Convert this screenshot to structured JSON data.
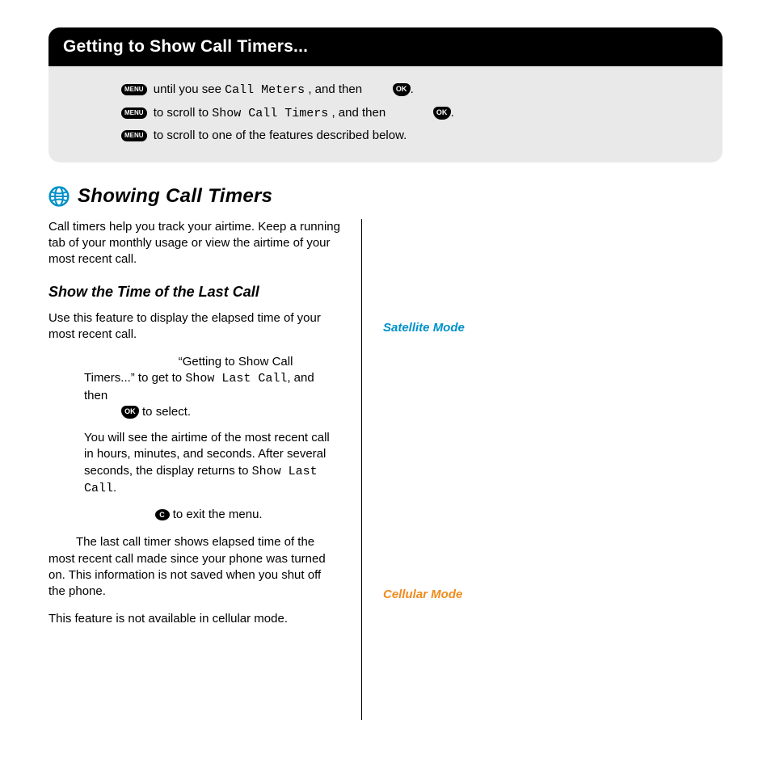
{
  "header": {
    "title": "Getting to Show Call Timers..."
  },
  "steps": {
    "s1a": " until you see ",
    "s1m": "Call Meters",
    "s1b": ", and then ",
    "s2a": " to scroll to ",
    "s2m": "Show Call Timers",
    "s2b": ", and then ",
    "s3a": " to scroll to one of the features described below."
  },
  "badges": {
    "menu": "MENU",
    "ok": "OK",
    "c": "C"
  },
  "section": {
    "title": "Showing Call Timers"
  },
  "intro": "Call timers help you track your airtime. Keep a running tab of your monthly usage or view the airtime of your most recent call.",
  "sub1": "Show the Time of the Last Call",
  "p1": "Use this feature to display the elapsed time of your most recent call.",
  "step1a": "“Getting to Show Call Timers...” to get to ",
  "step1m": "Show Last Call",
  "step1b": ", and then ",
  "step1c": " to select.",
  "res1a": "You will see the airtime of the most recent call in hours, minutes, and seconds. After several seconds, the display returns to ",
  "res1m": "Show Last Call",
  "res1b": ".",
  "exit": " to exit the menu.",
  "note": "The last call timer shows elapsed time of the most recent call made since your phone was turned on. This information is not saved when you shut off the phone.",
  "na": "This feature is not available in cellular mode.",
  "right": {
    "sat": "Satellite Mode",
    "cell": "Cellular Mode"
  }
}
